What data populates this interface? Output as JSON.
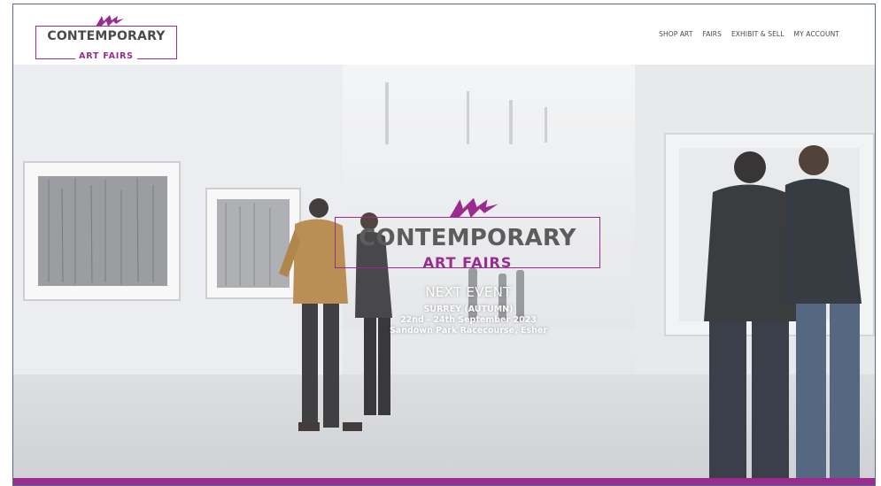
{
  "header": {
    "logo": {
      "line1": "CONTEMPORARY",
      "line2": "ART FAIRS"
    },
    "nav": [
      {
        "label": "SHOP ART"
      },
      {
        "label": "FAIRS"
      },
      {
        "label": "EXHIBIT & SELL"
      },
      {
        "label": "MY ACCOUNT"
      }
    ]
  },
  "hero": {
    "logo": {
      "line1": "CONTEMPORARY",
      "line2": "ART FAIRS"
    },
    "event": {
      "title": "NEXT EVENT",
      "name": "SURREY (AUTUMN)",
      "dates": "22nd - 24th September 2023",
      "venue": "Sandown Park Racecourse, Esher"
    }
  },
  "colors": {
    "brand": "#9b2c8f",
    "logo_text": "#4a4a4a",
    "background": "#ffffff"
  }
}
